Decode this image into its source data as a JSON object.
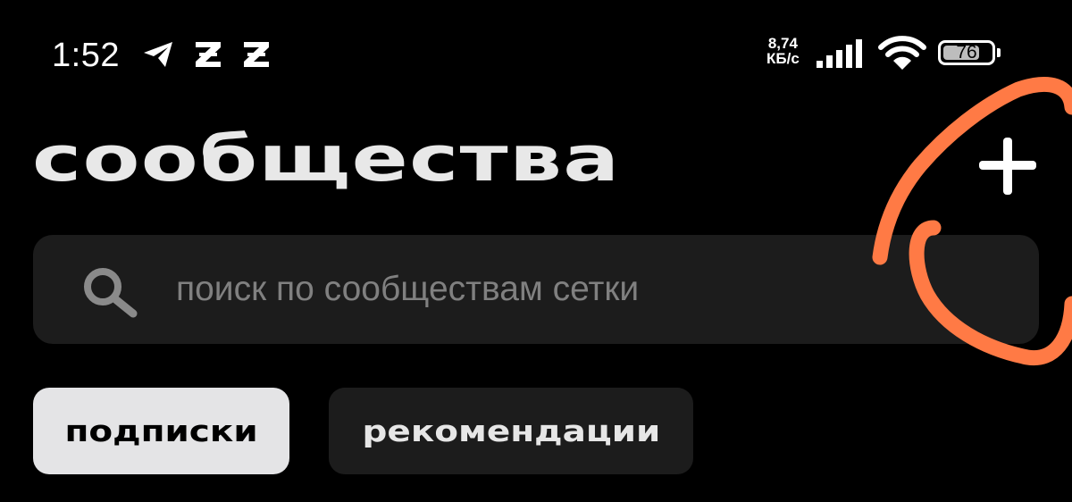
{
  "status_bar": {
    "time": "1:52",
    "notification_icons": [
      "telegram-icon",
      "z-app-icon",
      "z-app-icon"
    ],
    "net_speed_value": "8,74",
    "net_speed_unit": "КБ/с",
    "battery_level": "76",
    "battery_percent": 76
  },
  "header": {
    "title": "сообщества",
    "add_icon": "plus-icon"
  },
  "search": {
    "placeholder": "поиск по сообществам сетки",
    "value": "",
    "icon": "search-icon"
  },
  "tabs": [
    {
      "label": "подписки",
      "selected": true
    },
    {
      "label": "рекомендации",
      "selected": false
    }
  ],
  "colors": {
    "background": "#000000",
    "surface": "#1c1c1c",
    "title": "#e8e8e8",
    "active_tab": "#e4e4e6",
    "annotation": "#ff7a45"
  }
}
